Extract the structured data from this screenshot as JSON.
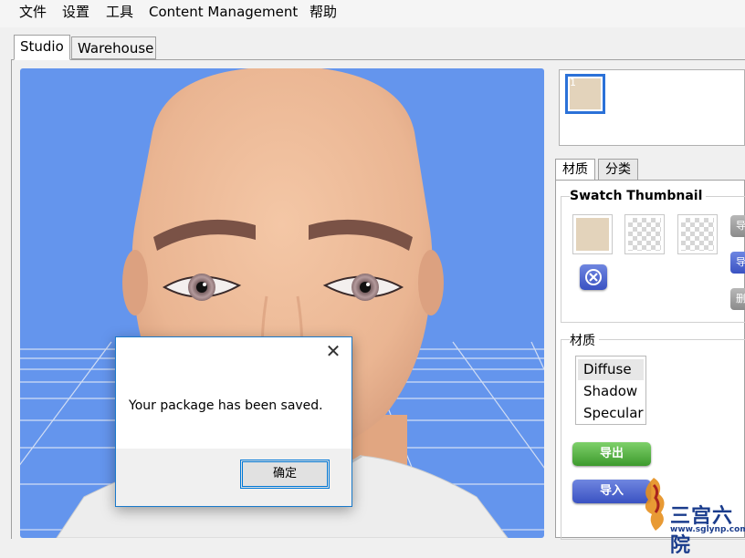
{
  "menu": [
    "文件",
    "设置",
    "工具",
    "Content Management",
    "帮助"
  ],
  "main_tabs": [
    {
      "label": "Studio",
      "active": true
    },
    {
      "label": "Warehouse",
      "active": false
    }
  ],
  "thumbnail_strip": {
    "selected_index": "1"
  },
  "sub_tabs": [
    {
      "label": "材质",
      "active": true
    },
    {
      "label": "分类",
      "active": false
    }
  ],
  "swatch_section": {
    "title": "Swatch Thumbnail",
    "swatch_color": "#e3d3bb",
    "side_buttons": [
      "导",
      "导",
      "删"
    ]
  },
  "material_section": {
    "title": "材质",
    "list": [
      "Diffuse",
      "Shadow",
      "Specular"
    ],
    "selected": "Diffuse"
  },
  "buttons": {
    "export": "导出",
    "import": "导入"
  },
  "dialog": {
    "message": "Your package has been saved.",
    "ok_label": "确定",
    "close_glyph": "✕"
  },
  "watermark": {
    "brand": "三宫六院",
    "url": "www.sglynp.com"
  },
  "colors": {
    "viewport_bg": "#6495ed",
    "accent": "#1979ca",
    "skin": "#ecb998",
    "green_button": "#4fa83f",
    "blue_button": "#3f55c6"
  }
}
